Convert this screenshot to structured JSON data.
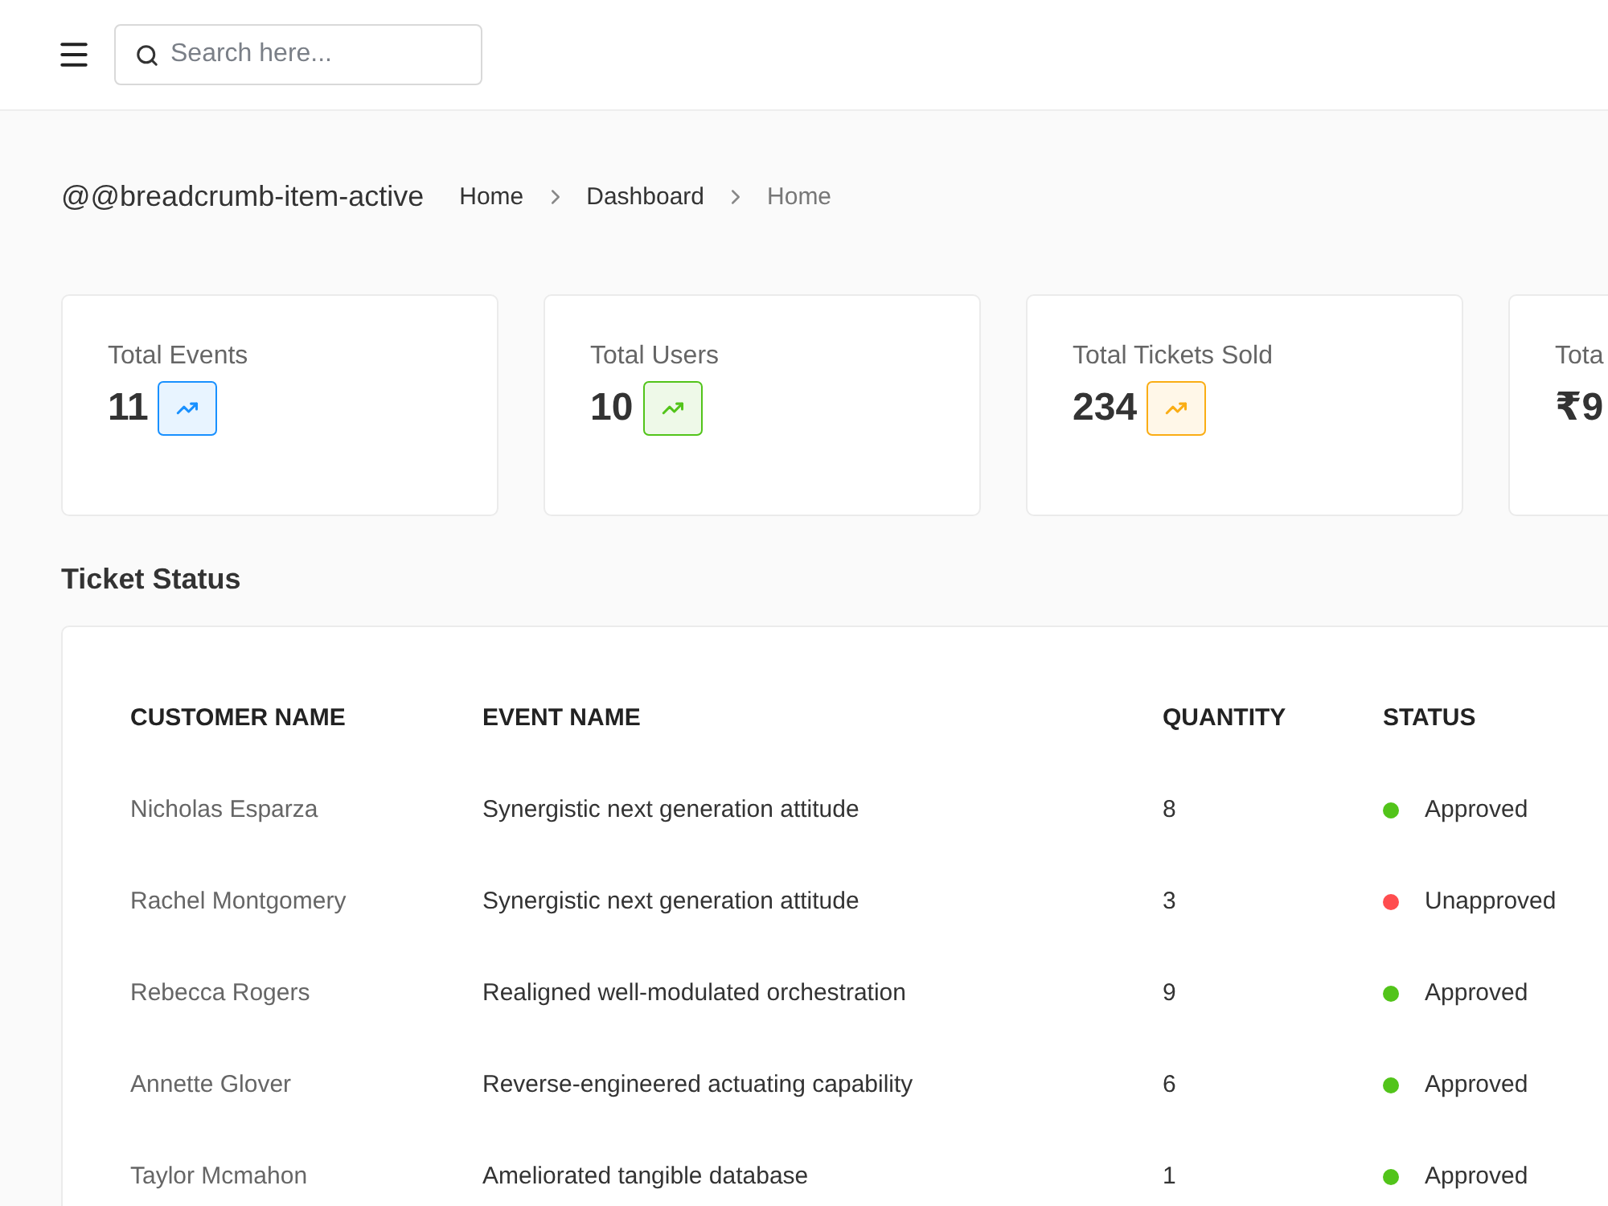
{
  "header": {
    "search": {
      "placeholder": "Search here..."
    }
  },
  "page": {
    "title": "@@breadcrumb-item-active",
    "breadcrumb": [
      {
        "label": "Home",
        "active": false
      },
      {
        "label": "Dashboard",
        "active": false
      },
      {
        "label": "Home",
        "active": true
      }
    ]
  },
  "stats": [
    {
      "label": "Total Events",
      "value": "11",
      "color": "#1890ff"
    },
    {
      "label": "Total Users",
      "value": "10",
      "color": "#52c41a"
    },
    {
      "label": "Total Tickets Sold",
      "value": "234",
      "color": "#faad14"
    },
    {
      "label": "Tota",
      "value": "₹9"
    }
  ],
  "ticket_status": {
    "title": "Ticket Status",
    "columns": [
      "CUSTOMER NAME",
      "EVENT NAME",
      "QUANTITY",
      "STATUS"
    ],
    "rows": [
      {
        "customer": "Nicholas Esparza",
        "event": "Synergistic next generation attitude",
        "quantity": "8",
        "status": "Approved",
        "color": "#52c41a"
      },
      {
        "customer": "Rachel Montgomery",
        "event": "Synergistic next generation attitude",
        "quantity": "3",
        "status": "Unapproved",
        "color": "#ff4d4f"
      },
      {
        "customer": "Rebecca Rogers",
        "event": "Realigned well-modulated orchestration",
        "quantity": "9",
        "status": "Approved",
        "color": "#52c41a"
      },
      {
        "customer": "Annette Glover",
        "event": "Reverse-engineered actuating capability",
        "quantity": "6",
        "status": "Approved",
        "color": "#52c41a"
      },
      {
        "customer": "Taylor Mcmahon",
        "event": "Ameliorated tangible database",
        "quantity": "1",
        "status": "Approved",
        "color": "#52c41a"
      }
    ]
  }
}
